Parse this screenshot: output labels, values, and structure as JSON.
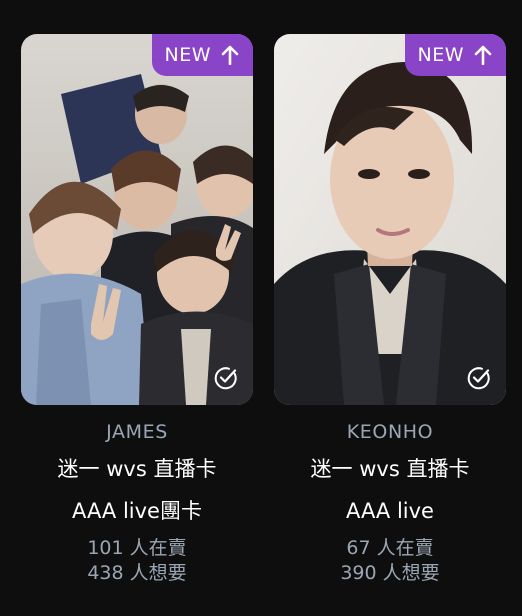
{
  "cards": [
    {
      "badge": "NEW",
      "artist": "JAMES",
      "title_line1": "迷一 wvs 直播卡",
      "title_line2": "AAA live團卡",
      "selling": "101 人在賣",
      "wanting": "438 人想要"
    },
    {
      "badge": "NEW",
      "artist": "KEONHO",
      "title_line1": "迷一 wvs 直播卡",
      "title_line2": "AAA live",
      "selling": "67 人在賣",
      "wanting": "390 人想要"
    }
  ],
  "colors": {
    "background": "#0e0e0e",
    "badge": "#8a44c8",
    "muted_text": "#9aa6b3",
    "primary_text": "#ffffff"
  },
  "icons": {
    "badge_arrow": "arrow-up-icon",
    "selected_mark": "check-circle-icon"
  }
}
